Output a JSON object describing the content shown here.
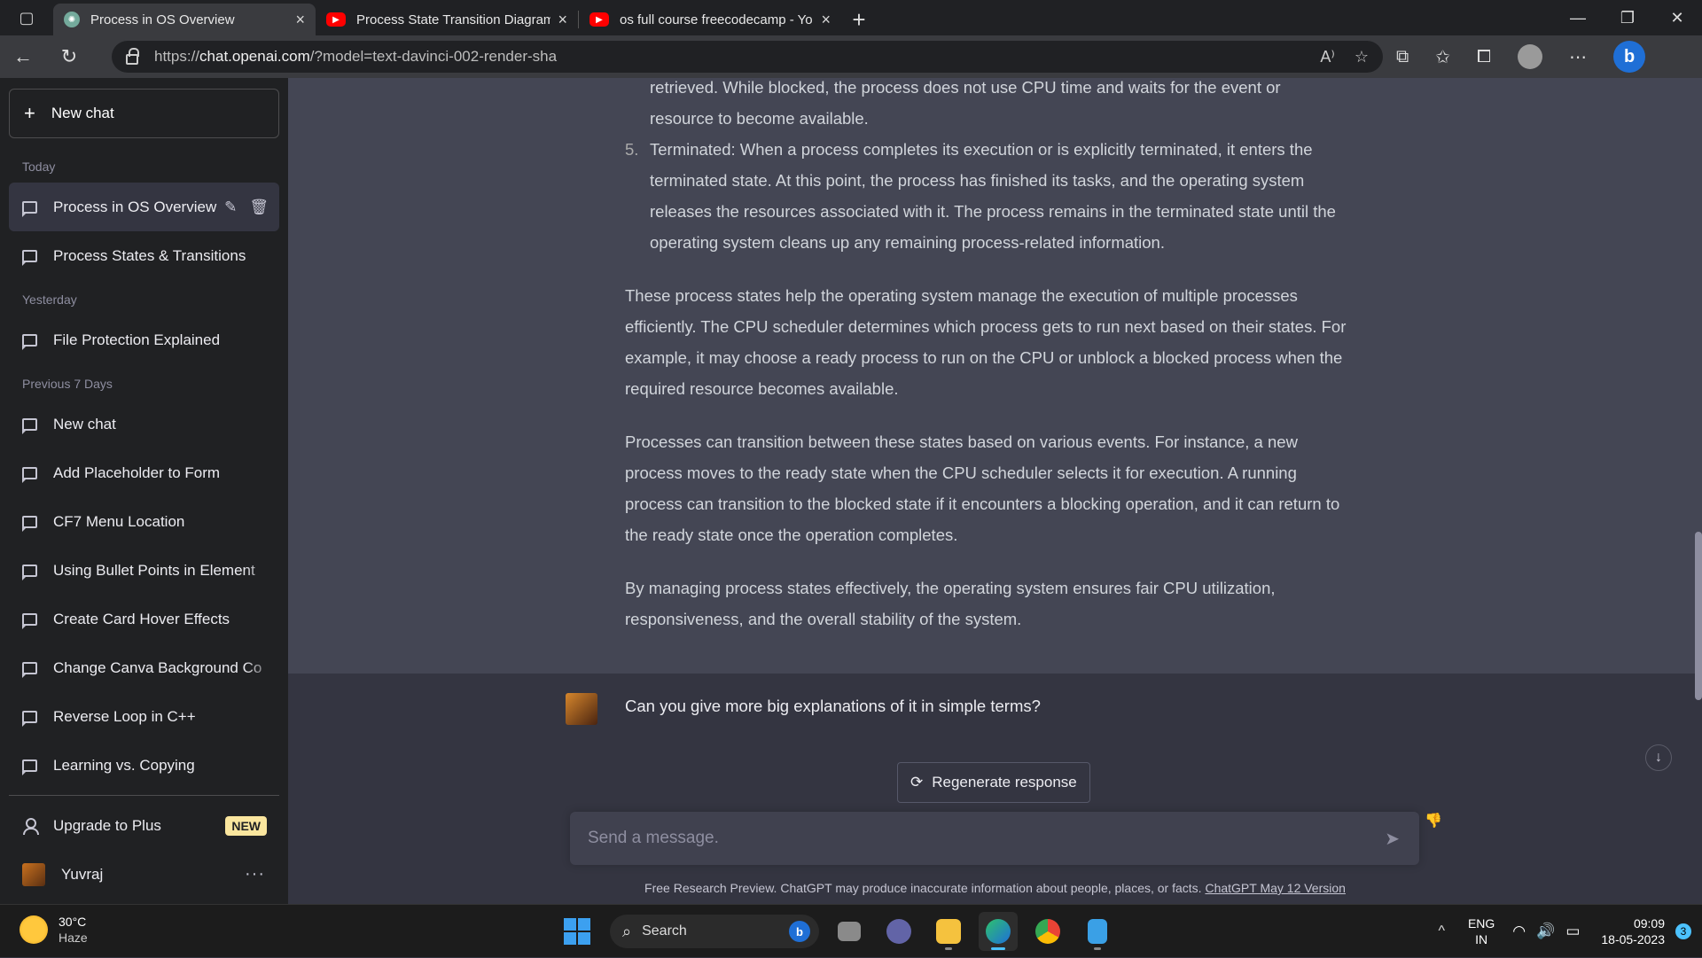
{
  "browser": {
    "tabs": [
      {
        "title": "Process in OS Overview",
        "favicon": "chatgpt-icon",
        "active": true
      },
      {
        "title": "Process State Transition Diagram",
        "favicon": "youtube-icon",
        "active": false
      },
      {
        "title": "os full course freecodecamp - Yo",
        "favicon": "youtube-icon",
        "active": false
      }
    ],
    "url_prefix": "https://",
    "url_host": "chat.openai.com",
    "url_path": "/?model=text-davinci-002-render-sha"
  },
  "sidebar": {
    "new_chat": "New chat",
    "sections": {
      "today": "Today",
      "yesterday": "Yesterday",
      "previous": "Previous 7 Days"
    },
    "today_items": [
      "Process in OS Overview",
      "Process States & Transitions"
    ],
    "yesterday_items": [
      "File Protection Explained"
    ],
    "previous_items": [
      "New chat",
      "Add Placeholder to Form",
      "CF7 Menu Location",
      "Using Bullet Points in Element",
      "Create Card Hover Effects",
      "Change Canva Background Co",
      "Reverse Loop in C++",
      "Learning vs. Copying"
    ],
    "upgrade": "Upgrade to Plus",
    "upgrade_badge": "NEW",
    "user_name": "Yuvraj"
  },
  "conversation": {
    "assistant": {
      "cont_line_1": "retrieved. While blocked, the process does not use CPU time and waits for the event or",
      "cont_line_2": "resource to become available.",
      "item5_num": "5.",
      "item5_text": "Terminated: When a process completes its execution or is explicitly terminated, it enters the terminated state. At this point, the process has finished its tasks, and the operating system releases the resources associated with it. The process remains in the terminated state until the operating system cleans up any remaining process-related information.",
      "para1": "These process states help the operating system manage the execution of multiple processes efficiently. The CPU scheduler determines which process gets to run next based on their states. For example, it may choose a ready process to run on the CPU or unblock a blocked process when the required resource becomes available.",
      "para2": "Processes can transition between these states based on various events. For instance, a new process moves to the ready state when the CPU scheduler selects it for execution. A running process can transition to the blocked state if it encounters a blocking operation, and it can return to the ready state once the operation completes.",
      "para3": "By managing process states effectively, the operating system ensures fair CPU utilization, responsiveness, and the overall stability of the system."
    },
    "user_message": "Can you give more big explanations of it in simple terms?"
  },
  "composer": {
    "regenerate": "Regenerate response",
    "placeholder": "Send a message.",
    "disclaimer": "Free Research Preview. ChatGPT may produce inaccurate information about people, places, or facts.",
    "version_link": "ChatGPT May 12 Version"
  },
  "taskbar": {
    "temperature": "30°C",
    "condition": "Haze",
    "search": "Search",
    "lang_1": "ENG",
    "lang_2": "IN",
    "time": "09:09",
    "date": "18-05-2023",
    "notifications": "3"
  },
  "colors": {
    "sidebar_bg": "#202123",
    "main_bg": "#343541",
    "assistant_bg": "#444654",
    "badge": "#fae69e"
  }
}
